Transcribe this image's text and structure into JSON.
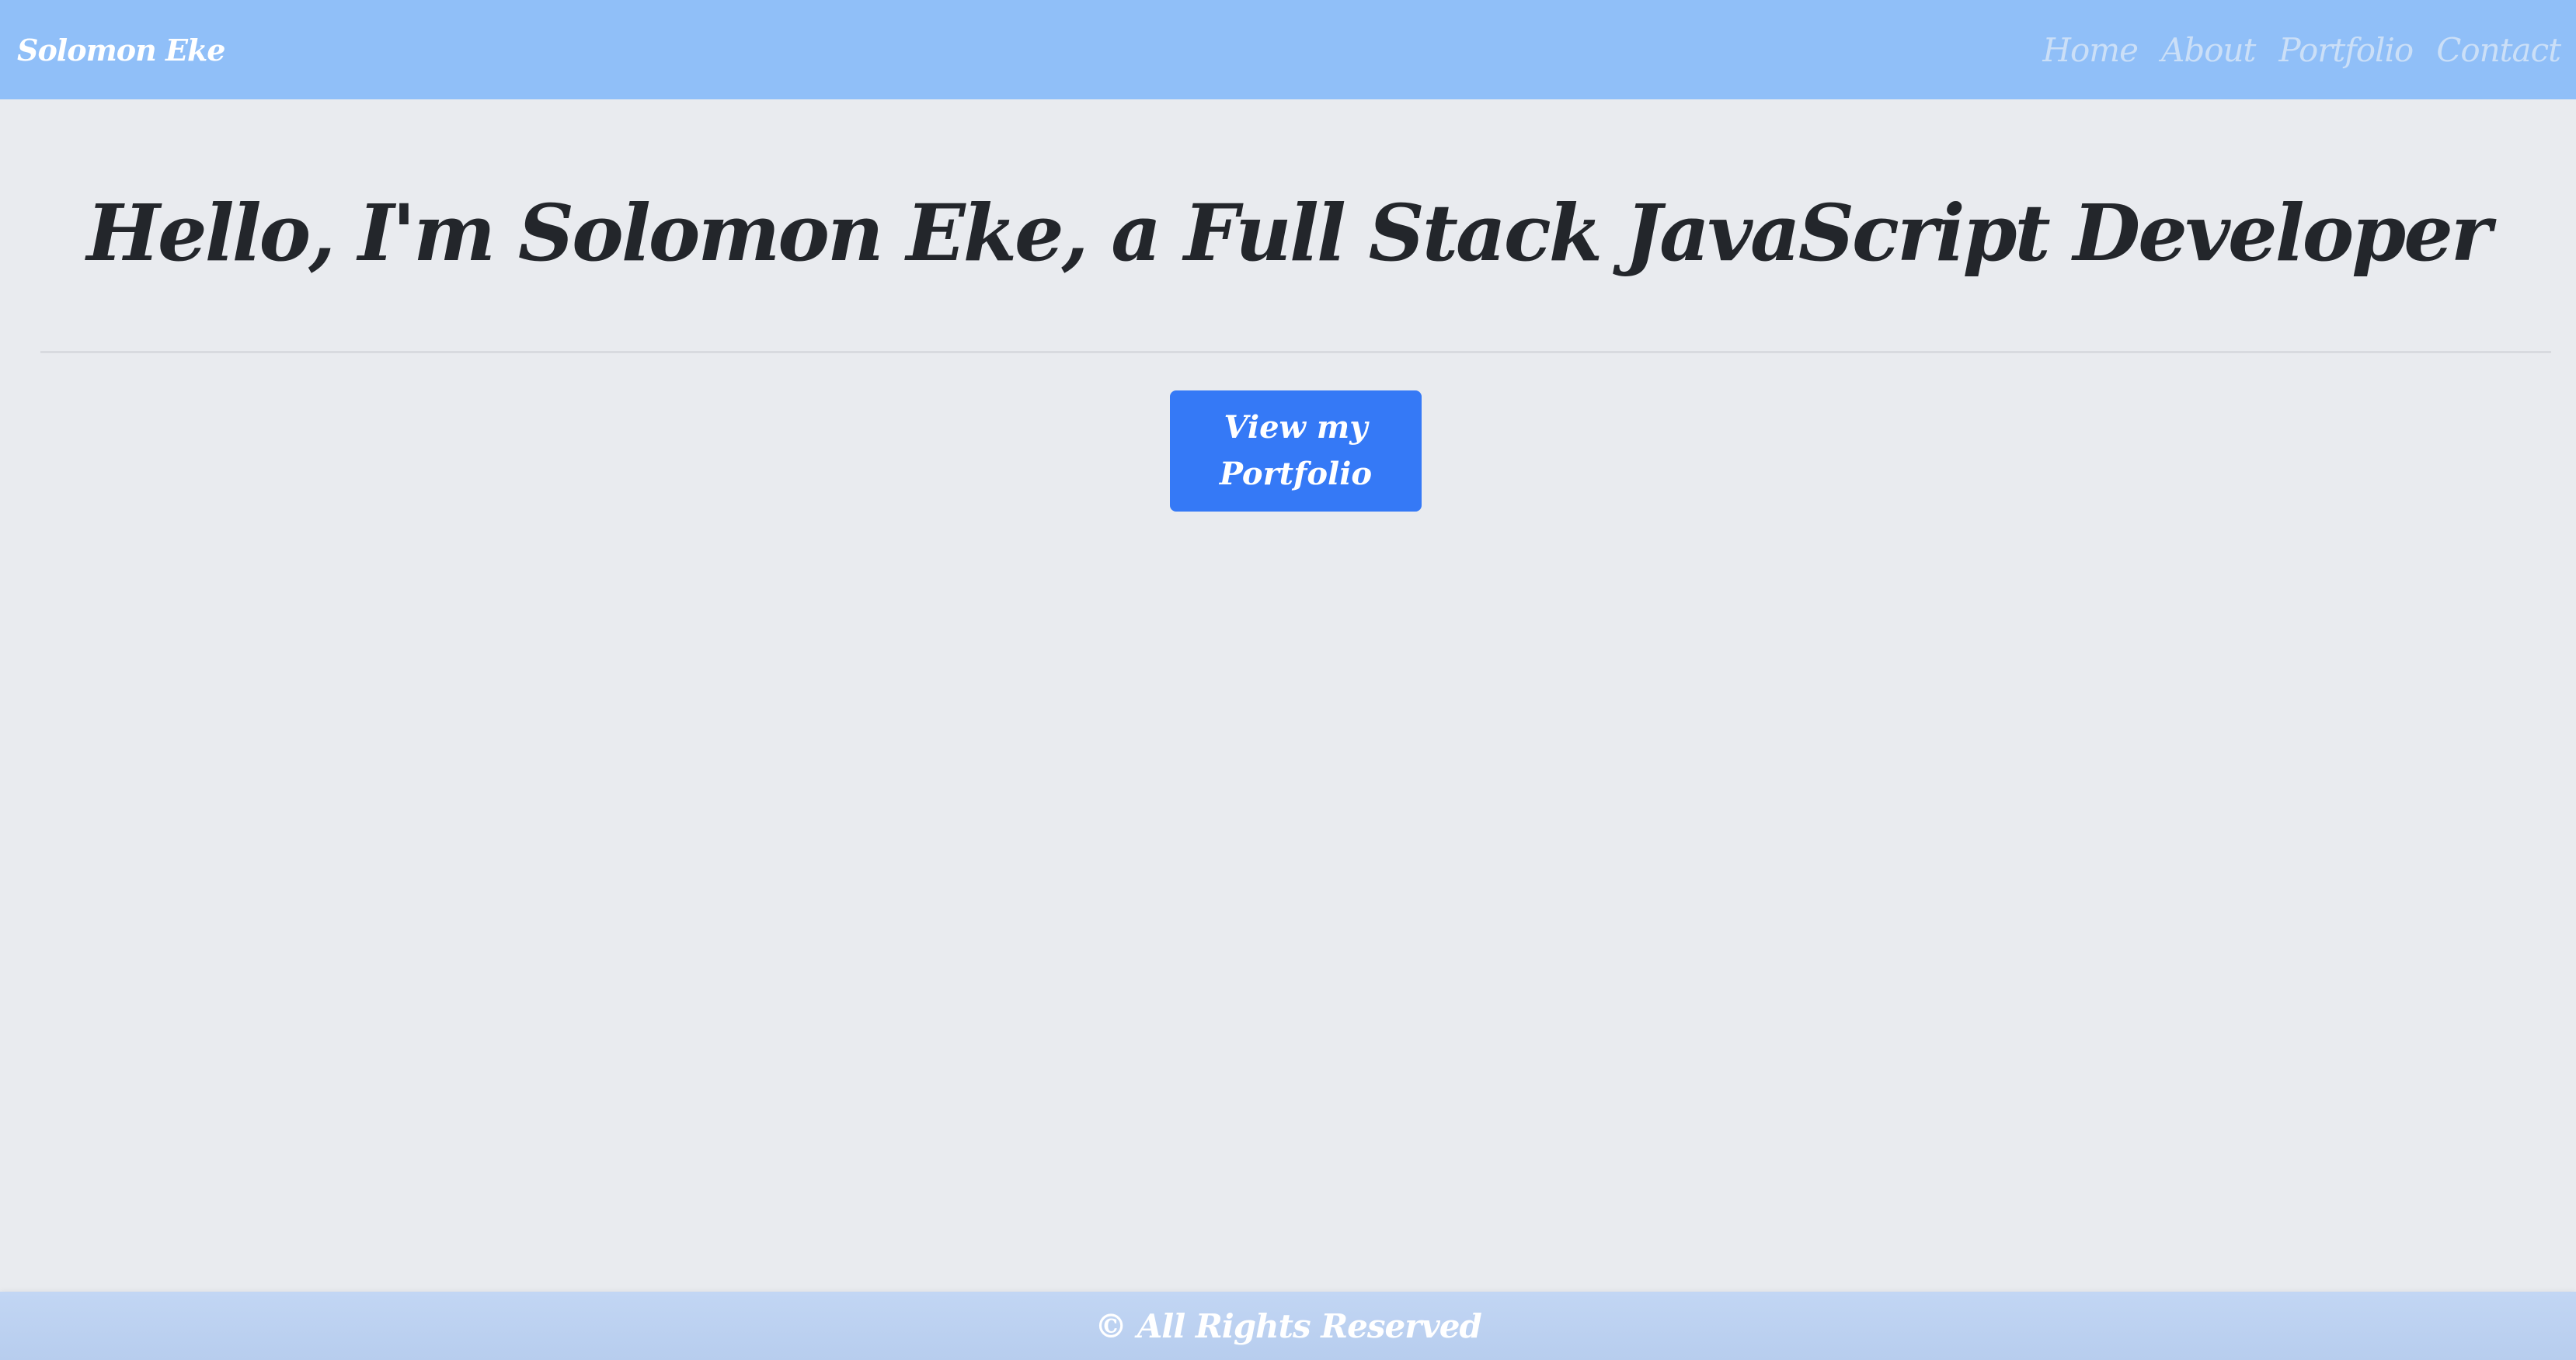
{
  "navbar": {
    "brand": "Solomon Eke",
    "links": [
      "Home",
      "About",
      "Portfolio",
      "Contact"
    ]
  },
  "hero": {
    "headline": "Hello, I'm Solomon Eke, a Full Stack JavaScript Developer",
    "cta_label": "View my Portfolio"
  },
  "footer": {
    "text": "© All Rights Reserved"
  },
  "colors": {
    "navbar_bg": "#90bff8",
    "page_bg": "#e9ebef",
    "button_bg": "#3579f6",
    "footer_bg": "#c2d6f4",
    "headline_text": "#23262b"
  }
}
